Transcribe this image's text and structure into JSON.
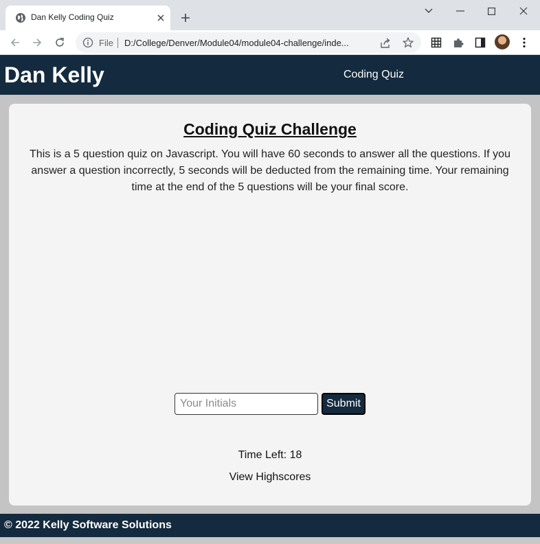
{
  "browser": {
    "tab_title": "Dan Kelly Coding Quiz",
    "omnibox_scheme": "File",
    "url": "D:/College/Denver/Module04/module04-challenge/inde..."
  },
  "header": {
    "brand": "Dan Kelly",
    "nav_label": "Coding Quiz"
  },
  "quiz": {
    "title": "Coding Quiz Challenge",
    "description": "This is a 5 question quiz on Javascript. You will have 60 seconds to answer all the questions. If you answer a question incorrectly, 5 seconds will be deducted from the remaining time. Your remaining time at the end of the 5 questions will be your final score.",
    "initials_placeholder": "Your Initials",
    "initials_value": "",
    "submit_label": "Submit",
    "time_left": "Time Left: 18",
    "view_highscores": "View Highscores"
  },
  "footer": {
    "text": "© 2022 Kelly Software Solutions"
  },
  "colors": {
    "navy": "#142a3e",
    "card": "#f4f4f4",
    "page_bg": "#c4c4c4"
  }
}
